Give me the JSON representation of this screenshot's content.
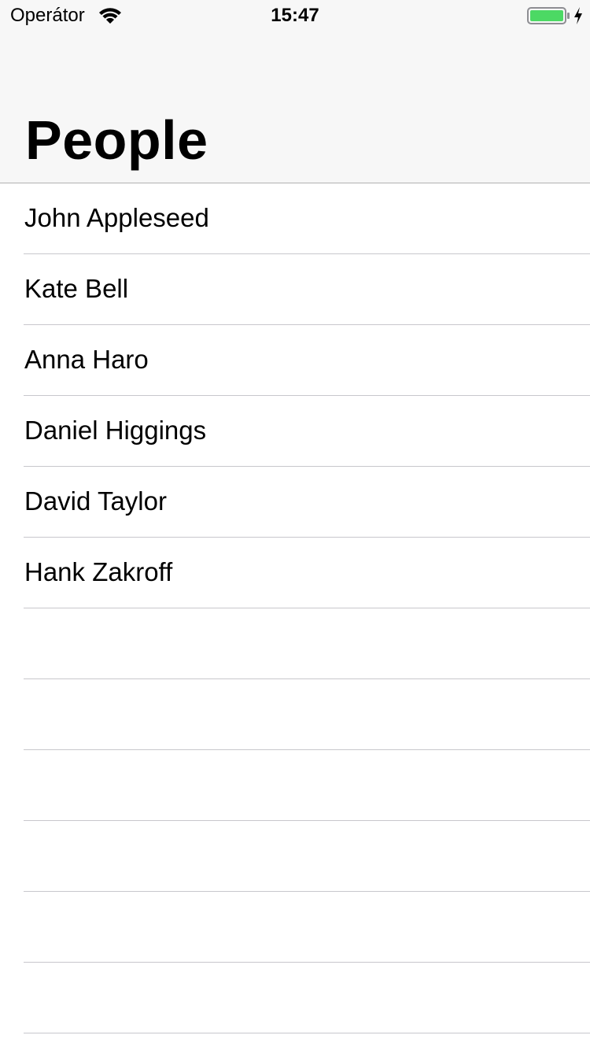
{
  "status_bar": {
    "carrier": "Operátor",
    "time": "15:47",
    "wifi_icon": "wifi-icon",
    "battery_icon": "battery-charging-icon",
    "battery_level": 1.0,
    "battery_color": "#4cd964"
  },
  "navigation": {
    "title": "People"
  },
  "people": [
    {
      "name": "John Appleseed"
    },
    {
      "name": "Kate Bell"
    },
    {
      "name": "Anna Haro"
    },
    {
      "name": "Daniel Higgings"
    },
    {
      "name": "David Taylor"
    },
    {
      "name": "Hank Zakroff"
    }
  ],
  "empty_rows": 6
}
